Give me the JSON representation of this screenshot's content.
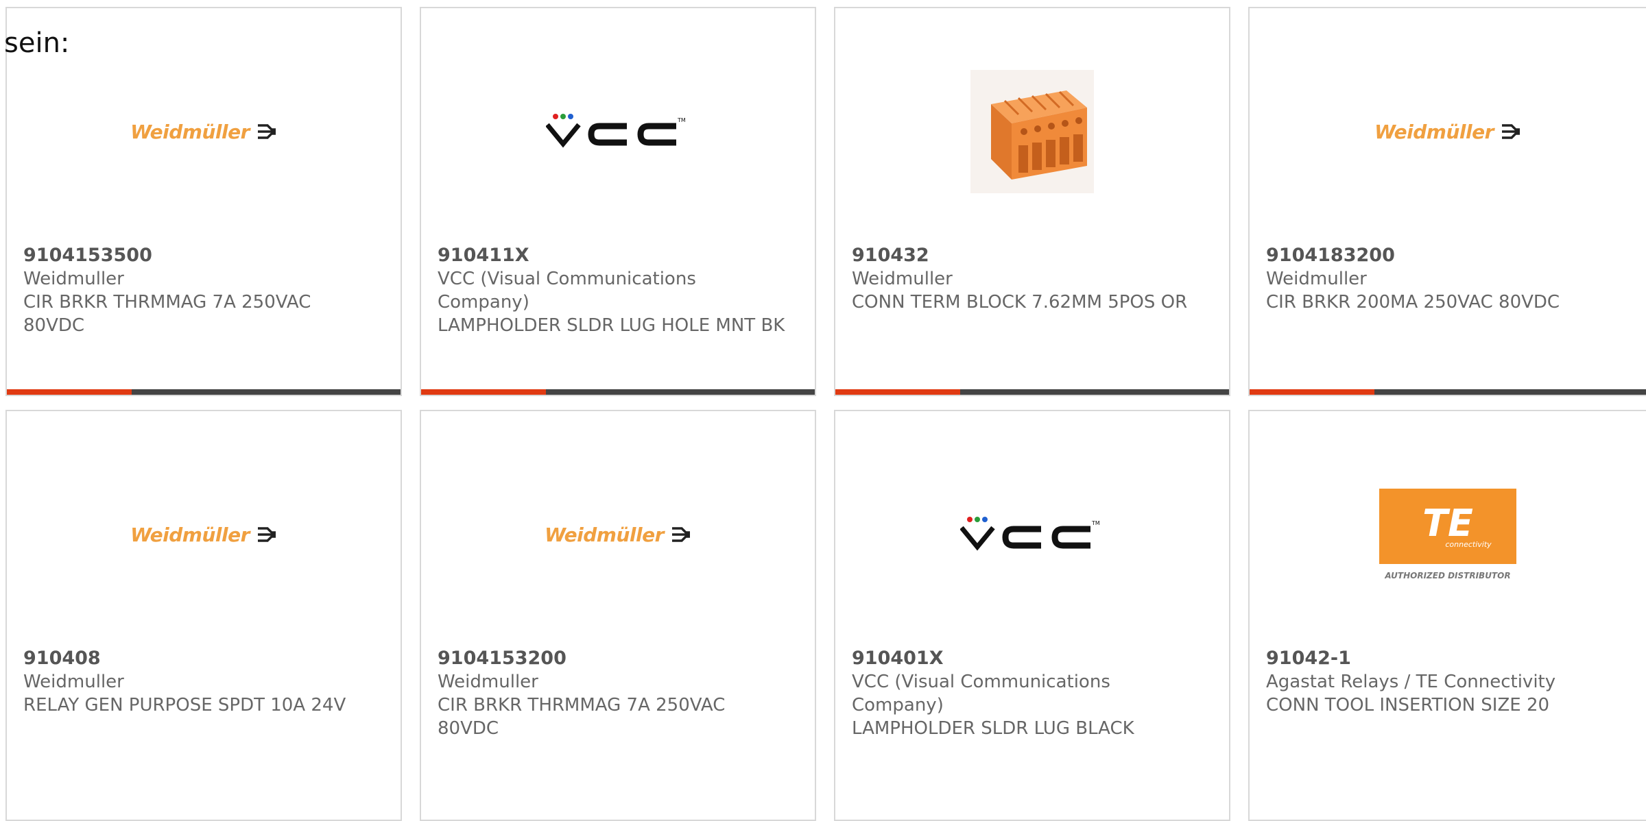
{
  "intro_text": "sein:",
  "colors": {
    "accent": "#e03a12",
    "bar": "#444444",
    "weidmuller_orange": "#f0a040",
    "te_orange": "#f3932a"
  },
  "logos": {
    "weidmuller": "Weidmüller",
    "vcc": "VCC",
    "te_main": "TE",
    "te_sub": "connectivity",
    "te_authorized": "AUTHORIZED DISTRIBUTOR"
  },
  "products": [
    {
      "part": "9104153500",
      "manufacturer": "Weidmuller",
      "description": "CIR BRKR THRMMAG 7A 250VAC 80VDC",
      "image": "weidmuller-logo"
    },
    {
      "part": "910411X",
      "manufacturer": "VCC (Visual Communications Company)",
      "description": "LAMPHOLDER SLDR LUG HOLE MNT BK",
      "image": "vcc-logo"
    },
    {
      "part": "910432",
      "manufacturer": "Weidmuller",
      "description": "CONN TERM BLOCK 7.62MM 5POS OR",
      "image": "terminal-block-photo"
    },
    {
      "part": "9104183200",
      "manufacturer": "Weidmuller",
      "description": "CIR BRKR 200MA 250VAC 80VDC",
      "image": "weidmuller-logo"
    },
    {
      "part": "910408",
      "manufacturer": "Weidmuller",
      "description": "RELAY GEN PURPOSE SPDT 10A 24V",
      "image": "weidmuller-logo"
    },
    {
      "part": "9104153200",
      "manufacturer": "Weidmuller",
      "description": "CIR BRKR THRMMAG 7A 250VAC 80VDC",
      "image": "weidmuller-logo"
    },
    {
      "part": "910401X",
      "manufacturer": "VCC (Visual Communications Company)",
      "description": "LAMPHOLDER SLDR LUG BLACK",
      "image": "vcc-logo"
    },
    {
      "part": "91042-1",
      "manufacturer": "Agastat Relays / TE Connectivity",
      "description": "CONN TOOL INSERTION SIZE 20",
      "image": "te-connectivity-logo"
    }
  ]
}
